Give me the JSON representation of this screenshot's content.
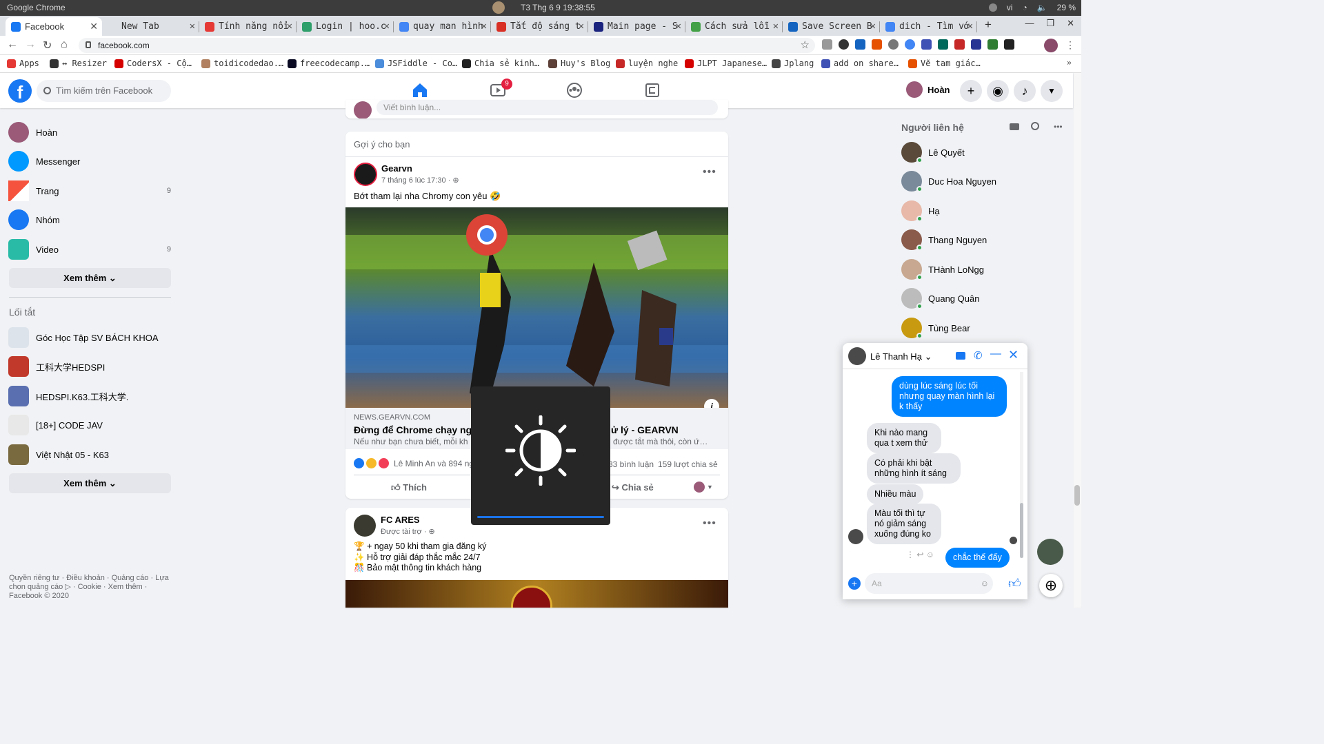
{
  "system": {
    "app_title": "Google Chrome",
    "clock": "T3 Thg 6 9  19:38:55",
    "lang": "vi",
    "battery": "29 %"
  },
  "tabs": [
    {
      "label": "Facebook",
      "color": "#1877f2",
      "active": true
    },
    {
      "label": "New Tab",
      "color": "#dee1e6"
    },
    {
      "label": "Tính năng nổi",
      "color": "#e53935"
    },
    {
      "label": "Login | hoo.c",
      "color": "#2e9e6a"
    },
    {
      "label": "quay man hình",
      "color": "#4285f4"
    },
    {
      "label": "Tắt độ sáng t",
      "color": "#d93025"
    },
    {
      "label": "Main page - S",
      "color": "#1a237e"
    },
    {
      "label": "Cách sửa lỗi",
      "color": "#43a047"
    },
    {
      "label": "Save Screen B",
      "color": "#1565c0"
    },
    {
      "label": "dich - Tìm vớ",
      "color": "#4285f4"
    }
  ],
  "url": "facebook.com",
  "bookmarks": [
    {
      "label": "Apps",
      "color": "#e53935"
    },
    {
      "label": "↔ Resizer",
      "color": "#333"
    },
    {
      "label": "CodersX - Cộ…",
      "color": "#d50000"
    },
    {
      "label": "toidicodedao.…",
      "color": "#b08060"
    },
    {
      "label": "freecodecamp.…",
      "color": "#0a0a23"
    },
    {
      "label": "JSFiddle - Co…",
      "color": "#4b8ddb"
    },
    {
      "label": "Chia sẻ kinh…",
      "color": "#222"
    },
    {
      "label": "Huy's Blog",
      "color": "#5d4037"
    },
    {
      "label": "luyện nghe",
      "color": "#c62828"
    },
    {
      "label": "JLPT Japanese…",
      "color": "#d50000"
    },
    {
      "label": "Jplang",
      "color": "#444"
    },
    {
      "label": "add on share…",
      "color": "#3f51b5"
    },
    {
      "label": "Vẽ tam giác…",
      "color": "#e65100"
    }
  ],
  "fb": {
    "search_placeholder": "Tìm kiếm trên Facebook",
    "video_badge": "9",
    "profile_name": "Hoàn",
    "left_menu": [
      {
        "label": "Hoàn",
        "count": ""
      },
      {
        "label": "Messenger",
        "count": ""
      },
      {
        "label": "Trang",
        "count": "9"
      },
      {
        "label": "Nhóm",
        "count": ""
      },
      {
        "label": "Video",
        "count": "9"
      }
    ],
    "see_more": "Xem thêm",
    "shortcuts_title": "Lối tắt",
    "shortcuts": [
      "Góc Học Tập SV BÁCH KHOA",
      "工科大学HEDSPI",
      "HEDSPI.K63.工科大学.",
      "[18+] CODE JAV",
      "Việt Nhật 05 - K63"
    ],
    "footer": "Quyền riêng tư · Điều khoản · Quảng cáo · Lựa chọn quảng cáo ▷ · Cookie · Xem thêm · Facebook © 2020"
  },
  "feed": {
    "comment_placeholder": "Viết bình luận...",
    "suggest_label": "Gợi ý cho bạn",
    "post1": {
      "author": "Gearvn",
      "time": "7 tháng 6 lúc 17:30 · ",
      "text": "Bớt tham lại nha Chromy con yêu 🤣",
      "link_domain": "NEWS.GEARVN.COM",
      "link_title_left": "Đừng để Chrome chạy ng",
      "link_title_right": "ử lý - GEARVN",
      "link_desc_left": "Nếu như bạn chưa biết, mỗi kh",
      "link_desc_right": "được tắt mà thôi, còn ứ…",
      "reactions": "Lê Minh An và 894 ng",
      "comments": "83 bình luận",
      "shares": "159 lượt chia sẻ",
      "like": "Thích",
      "share": "Chia sẻ"
    },
    "post2": {
      "author": "FC ARES",
      "sponsored": "Được tài trợ · ",
      "lines": [
        "🏆 + ngay 50 khi tham gia đăng ký",
        "✨ Hỗ trợ giải đáp thắc mắc 24/7",
        "🎊 Bảo mật thông tin khách hàng"
      ]
    }
  },
  "contacts": {
    "title": "Người liên hệ",
    "list": [
      "Lê Quyết",
      "Duc Hoa Nguyen",
      "Hạ",
      "Thang Nguyen",
      "THành LoNgg",
      "Quang Quân",
      "Tùng Bear"
    ]
  },
  "chat": {
    "name": "Lê Thanh Hạ",
    "messages": [
      {
        "dir": "out",
        "text": "dùng lúc sáng lúc tối nhưng quay màn hình lại k thấy"
      },
      {
        "dir": "in",
        "text": "Khi nào mang qua t xem thử"
      },
      {
        "dir": "in",
        "text": "Có phải khi bật những hình ít sáng"
      },
      {
        "dir": "in",
        "text": "Nhiều màu"
      },
      {
        "dir": "in",
        "text": "Màu tối thì tự nó giảm sáng xuống đúng ko"
      },
      {
        "dir": "out",
        "text": "chắc thế đấy"
      }
    ],
    "input_placeholder": "Aa"
  },
  "brightness_osd": {
    "level": 1.0
  }
}
